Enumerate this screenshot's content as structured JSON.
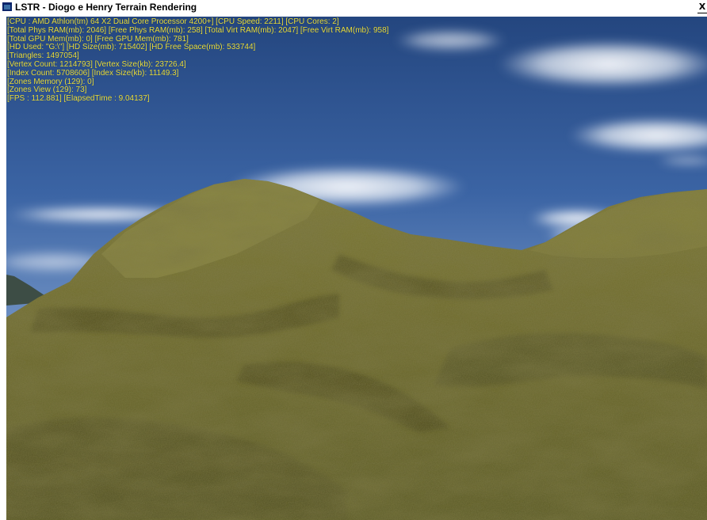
{
  "window": {
    "title": "LSTR - Diogo e Henry Terrain Rendering",
    "close_label": "X"
  },
  "colors": {
    "overlay_text": "#e8dc3c",
    "sky_top": "#2b4e8c",
    "sky_bottom": "#9fb8d8",
    "terrain_base": "#6e6a2c"
  },
  "stats": {
    "line1": "[CPU : AMD Athlon(tm) 64 X2 Dual Core Processor 4200+]  [CPU Speed: 2211]  [CPU Cores: 2]",
    "line2": "[Total Phys RAM(mb): 2046]  [Free Phys RAM(mb): 258]  [Total Virt RAM(mb): 2047]  [Free Virt RAM(mb): 958]",
    "line3": "[Total GPU Mem(mb): 0]  [Free GPU Mem(mb): 781]",
    "line4": "[HD Used: \"G:\\\"]  [HD Size(mb): 715402]  [HD Free Space(mb): 533744]",
    "line5": "[Triangles: 1497054]",
    "line6": "[Vertex Count: 1214793]  [Vertex Size(kb): 23726.4]",
    "line7": "[Index Count: 5708606]  [Index Size(kb): 11149.3]",
    "line8": "[Zones Memory (129): 0]",
    "line9": "[Zones View (129): 73]",
    "line10": "[FPS : 112.881]  [ElapsedTime : 9.04137]"
  }
}
